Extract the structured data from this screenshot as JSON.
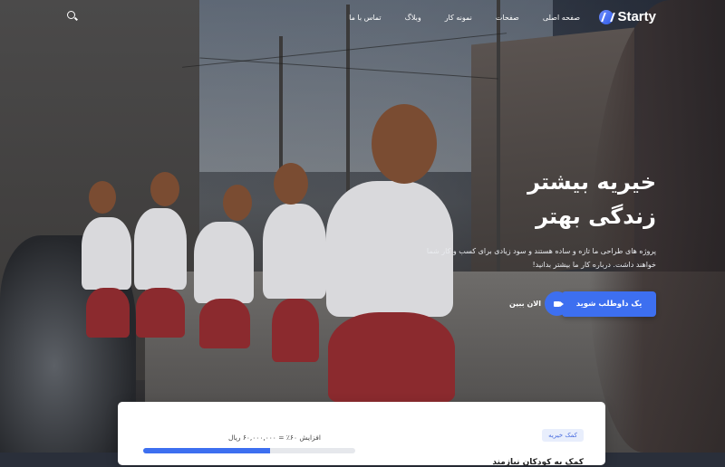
{
  "brand": {
    "name": "Starty",
    "logo_icon": "starty-logo-icon"
  },
  "nav": {
    "items": [
      "صفحه اصلی",
      "صفحات",
      "نمونه کار",
      "وبلاگ",
      "تماس با ما"
    ],
    "search_icon": "search-icon"
  },
  "hero": {
    "title_line1": "خیریه بیشتر",
    "title_line2": "زندگی بهتر",
    "description": "پروژه های طراحی ما تازه و ساده هستند و سود زیادی برای کسب و کار شما خواهند داشت. درباره کار ما بیشتر بدانید!",
    "cta_label": "یک داوطلب شوید",
    "video_label": "الان ببین",
    "video_icon": "video-camera-icon"
  },
  "donation_card": {
    "badge": "کمک خیریه",
    "raised_label": "افزایش ۶۰٪ = ۶۰,۰۰۰,۰۰۰ ریال",
    "progress_percent": 60,
    "title": "کمک به کودکان نیازمند"
  },
  "colors": {
    "accent": "#3d6ff0",
    "card_bg": "#ffffff"
  }
}
